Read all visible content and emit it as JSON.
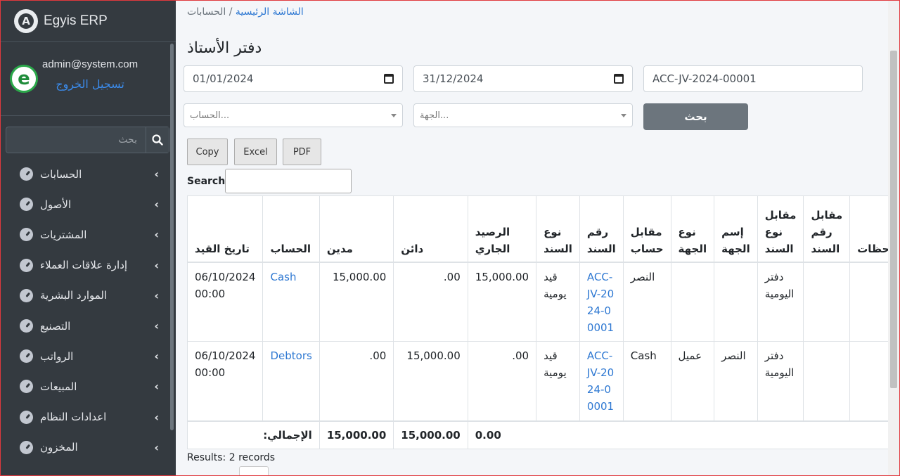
{
  "sidebar": {
    "brand": "Egyis ERP",
    "brand_logo_letter": "A",
    "avatar_letter": "e",
    "user_email": "admin@system.com",
    "logout_label": "تسجيل الخروج",
    "search_placeholder": "بحث",
    "items": [
      {
        "label": "الحسابات"
      },
      {
        "label": "الأصول"
      },
      {
        "label": "المشتريات"
      },
      {
        "label": "إدارة علاقات العملاء"
      },
      {
        "label": "الموارد البشرية"
      },
      {
        "label": "التصنيع"
      },
      {
        "label": "الرواتب"
      },
      {
        "label": "المبيعات"
      },
      {
        "label": "اعدادات النظام"
      },
      {
        "label": "المخزون"
      }
    ]
  },
  "breadcrumb": {
    "home": "الشاشة الرئيسية",
    "separator": "/",
    "current": "الحسابات"
  },
  "page": {
    "title": "دفتر الأستاذ"
  },
  "filters": {
    "date_from": "01/01/2024",
    "date_to": "31/12/2024",
    "voucher_no": "ACC-JV-2024-00001",
    "account_placeholder": "...الحساب",
    "party_placeholder": "...الجهة",
    "search_button": "بحث"
  },
  "exports": {
    "copy": "Copy",
    "excel": "Excel",
    "pdf": "PDF"
  },
  "dt_search_label": "Search:",
  "table": {
    "headers": {
      "posting_date": "تاريخ القيد",
      "account": "الحساب",
      "debit": "مدين",
      "credit": "دائن",
      "balance": "الرصيد الجاري",
      "voucher_type": "نوع السند",
      "voucher_no": "رقم السند",
      "against": "مقابل حساب",
      "party_type": "نوع الجهة",
      "party": "إسم الجهة",
      "against_voucher_type": "مقابل نوع السند",
      "against_voucher": "مقابل رقم السند",
      "remarks": "ملاحظات"
    },
    "rows": [
      {
        "posting_date": "06/10/2024 00:00",
        "account": "Cash",
        "debit": "15,000.00",
        "credit": ".00",
        "balance": "15,000.00",
        "voucher_type": "قيد يومية",
        "voucher_no": "ACC-JV-2024-00001",
        "against": "النصر",
        "party_type": "",
        "party": "",
        "against_voucher_type": "دفتر اليومية",
        "against_voucher": "",
        "remarks": ""
      },
      {
        "posting_date": "06/10/2024 00:00",
        "account": "Debtors",
        "debit": ".00",
        "credit": "15,000.00",
        "balance": ".00",
        "voucher_type": "قيد يومية",
        "voucher_no": "ACC-JV-2024-00001",
        "against": "Cash",
        "party_type": "عميل",
        "party": "النصر",
        "against_voucher_type": "دفتر اليومية",
        "against_voucher": "",
        "remarks": ""
      }
    ],
    "totals": {
      "label": "الإجمالي:",
      "debit": "15,000.00",
      "credit": "15,000.00",
      "balance": "0.00"
    }
  },
  "results_text": "Results: 2 records"
}
